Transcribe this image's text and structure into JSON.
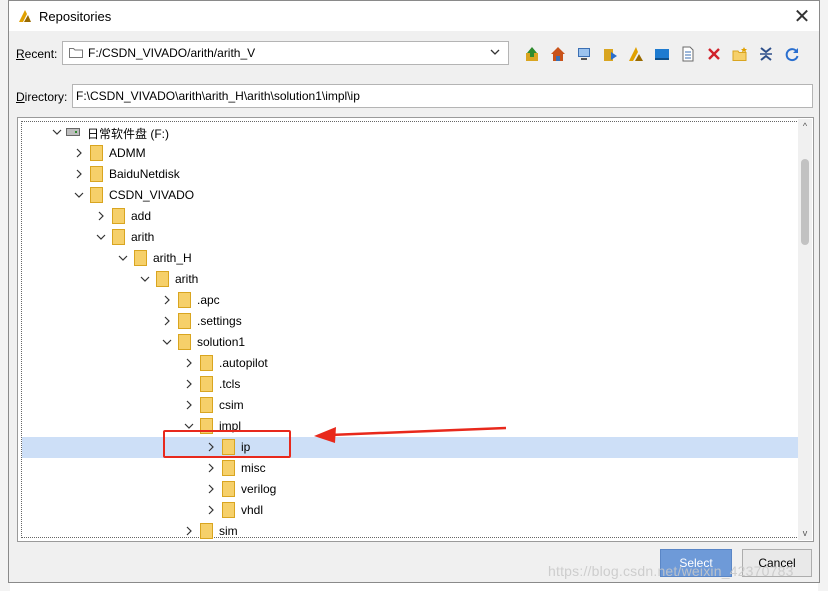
{
  "dialog": {
    "title": "Repositories",
    "recent_label_pre": "",
    "recent_label_u": "R",
    "recent_label_post": "ecent:",
    "recent_value": "F:/CSDN_VIVADO/arith/arith_V",
    "directory_label_pre": "",
    "directory_label_u": "D",
    "directory_label_post": "irectory:",
    "directory_value": "F:\\CSDN_VIVADO\\arith\\arith_H\\arith\\solution1\\impl\\ip",
    "select_label": "Select",
    "cancel_label": "Cancel"
  },
  "toolbar": [
    {
      "icon": "up-folder-icon",
      "color": "#2e8b2e"
    },
    {
      "icon": "home-icon",
      "color": "#c9531a"
    },
    {
      "icon": "computer-icon",
      "color": "#3b6fb3"
    },
    {
      "icon": "bookmark-folder-icon",
      "color": "#d9a520"
    },
    {
      "icon": "vivado-icon",
      "color": "#e0a000"
    },
    {
      "icon": "desktop-icon",
      "color": "#1e7bd0"
    },
    {
      "icon": "document-icon",
      "color": "#6a6a6a"
    },
    {
      "icon": "delete-icon",
      "color": "#d0212a"
    },
    {
      "icon": "new-folder-icon",
      "color": "#d9a520"
    },
    {
      "icon": "collapse-icon",
      "color": "#2d4f8a"
    },
    {
      "icon": "refresh-icon",
      "color": "#2a6fcf"
    }
  ],
  "tree": [
    {
      "label": "日常软件盘 (F:)",
      "depth": 0,
      "state": "expanded",
      "kind": "drive"
    },
    {
      "label": "ADMM",
      "depth": 1,
      "state": "collapsed",
      "kind": "folder"
    },
    {
      "label": "BaiduNetdisk",
      "depth": 1,
      "state": "collapsed",
      "kind": "folder"
    },
    {
      "label": "CSDN_VIVADO",
      "depth": 1,
      "state": "expanded",
      "kind": "folder"
    },
    {
      "label": "add",
      "depth": 2,
      "state": "collapsed",
      "kind": "folder"
    },
    {
      "label": "arith",
      "depth": 2,
      "state": "expanded",
      "kind": "folder"
    },
    {
      "label": "arith_H",
      "depth": 3,
      "state": "expanded",
      "kind": "folder"
    },
    {
      "label": "arith",
      "depth": 4,
      "state": "expanded",
      "kind": "folder"
    },
    {
      "label": ".apc",
      "depth": 5,
      "state": "collapsed",
      "kind": "folder"
    },
    {
      "label": ".settings",
      "depth": 5,
      "state": "collapsed",
      "kind": "folder"
    },
    {
      "label": "solution1",
      "depth": 5,
      "state": "expanded",
      "kind": "folder"
    },
    {
      "label": ".autopilot",
      "depth": 6,
      "state": "collapsed",
      "kind": "folder"
    },
    {
      "label": ".tcls",
      "depth": 6,
      "state": "collapsed",
      "kind": "folder"
    },
    {
      "label": "csim",
      "depth": 6,
      "state": "collapsed",
      "kind": "folder"
    },
    {
      "label": "impl",
      "depth": 6,
      "state": "expanded",
      "kind": "folder"
    },
    {
      "label": "ip",
      "depth": 7,
      "state": "collapsed",
      "kind": "folder",
      "selected": true
    },
    {
      "label": "misc",
      "depth": 7,
      "state": "collapsed",
      "kind": "folder"
    },
    {
      "label": "verilog",
      "depth": 7,
      "state": "collapsed",
      "kind": "folder"
    },
    {
      "label": "vhdl",
      "depth": 7,
      "state": "collapsed",
      "kind": "folder"
    },
    {
      "label": "sim",
      "depth": 6,
      "state": "collapsed",
      "kind": "folder"
    }
  ],
  "watermark": "https://blog.csdn.net/weixin_42370783",
  "colors": {
    "folder": "#f6d06a",
    "folder_edge": "#d9a520",
    "selection": "#cddff7",
    "annotation": "#e8291c",
    "primary_button": "#6e9ad8"
  }
}
